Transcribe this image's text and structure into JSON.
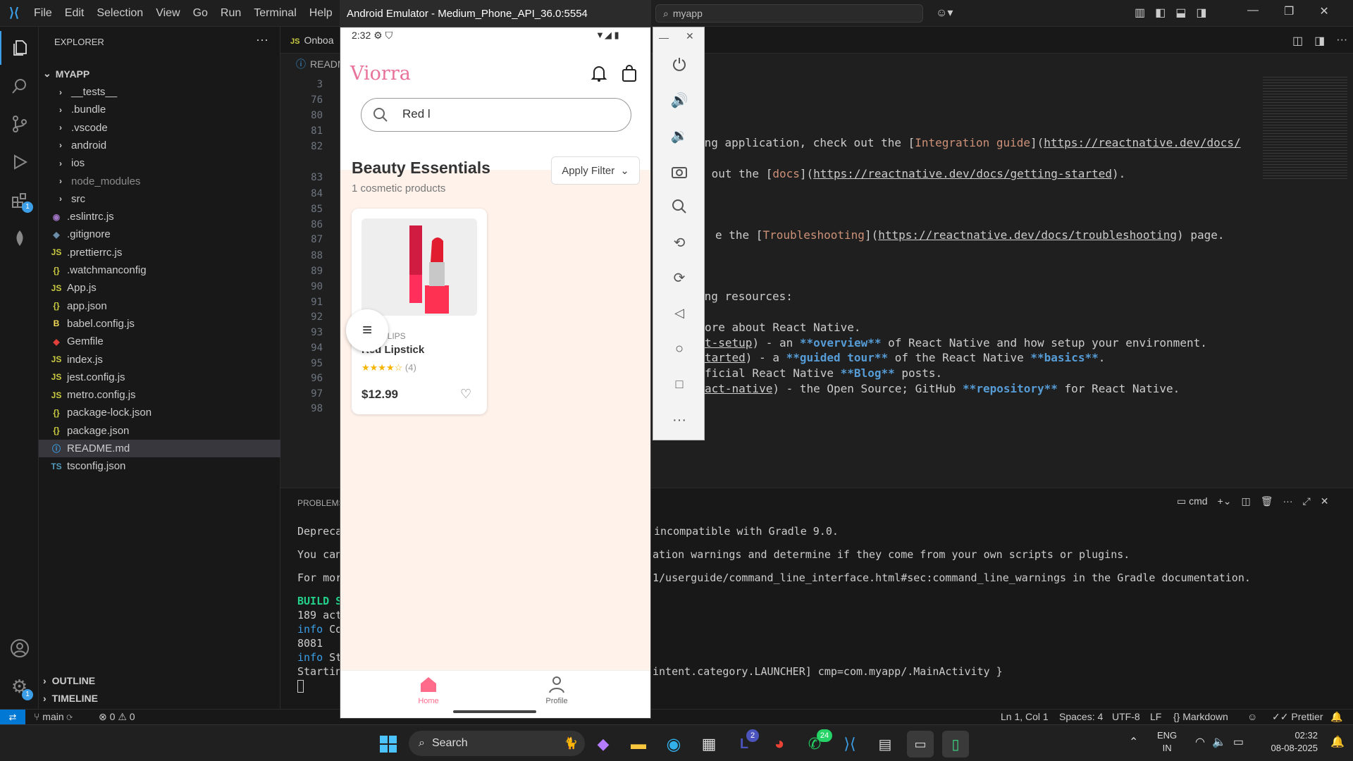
{
  "vscode": {
    "menu": [
      "File",
      "Edit",
      "Selection",
      "View",
      "Go",
      "Run",
      "Terminal",
      "Help"
    ],
    "command_center": "myapp",
    "explorer_title": "EXPLORER",
    "root_folder": "MYAPP",
    "tree": [
      {
        "name": "__tests__",
        "kind": "folder"
      },
      {
        "name": ".bundle",
        "kind": "folder"
      },
      {
        "name": ".vscode",
        "kind": "folder"
      },
      {
        "name": "android",
        "kind": "folder"
      },
      {
        "name": "ios",
        "kind": "folder"
      },
      {
        "name": "node_modules",
        "kind": "folder"
      },
      {
        "name": "src",
        "kind": "folder"
      },
      {
        "name": ".eslintrc.js",
        "kind": "eslint"
      },
      {
        "name": ".gitignore",
        "kind": "git"
      },
      {
        "name": ".prettierrc.js",
        "kind": "js"
      },
      {
        "name": ".watchmanconfig",
        "kind": "json"
      },
      {
        "name": "App.js",
        "kind": "js"
      },
      {
        "name": "app.json",
        "kind": "json"
      },
      {
        "name": "babel.config.js",
        "kind": "babel"
      },
      {
        "name": "Gemfile",
        "kind": "ruby"
      },
      {
        "name": "index.js",
        "kind": "js"
      },
      {
        "name": "jest.config.js",
        "kind": "js"
      },
      {
        "name": "metro.config.js",
        "kind": "js"
      },
      {
        "name": "package-lock.json",
        "kind": "json"
      },
      {
        "name": "package.json",
        "kind": "json"
      },
      {
        "name": "README.md",
        "kind": "info"
      },
      {
        "name": "tsconfig.json",
        "kind": "ts"
      }
    ],
    "outline_label": "OUTLINE",
    "timeline_label": "TIMELINE",
    "tab_partial": "Onboa",
    "breadcrumb_partial": "READM",
    "line_numbers": [
      "3",
      "76",
      "80",
      "81",
      "82",
      "83",
      "84",
      "85",
      "86",
      "87",
      "88",
      "89",
      "90",
      "91",
      "92",
      "93",
      "94",
      "95",
      "96",
      "97",
      "98"
    ],
    "code_fragments": {
      "l82a": "ing application, check out the [",
      "l82b": "Integration guide",
      "l82c": "](",
      "l82d": "https://reactnative.dev/docs/",
      "l83a": " out the [",
      "l83b": "docs",
      "l83c": "](",
      "l83d": "https://reactnative.dev/docs/getting-started",
      "l83e": ").",
      "l87a": "e the [",
      "l87b": "Troubleshooting",
      "l87c": "](",
      "l87d": "https://reactnative.dev/docs/troubleshooting",
      "l87e": ") page.",
      "l91": "ing resources:",
      "l93": "ore about React Native.",
      "l94a": "t-setup",
      "l94b": ") - an ",
      "l94c": "**overview**",
      "l94d": " of React Native and how setup your environment.",
      "l95a": "tarted",
      "l95b": ") - a ",
      "l95c": "**guided tour**",
      "l95d": " of the React Native ",
      "l95e": "**basics**",
      "l95f": ".",
      "l96a": "ficial React Native ",
      "l96b": "**Blog**",
      "l96c": " posts.",
      "l97a": "act-native",
      "l97b": ") - the Open Source; GitHub ",
      "l97c": "**repository**",
      "l97d": " for React Native."
    },
    "panel_tab": "PROBLEMS",
    "terminal_name": "cmd",
    "terminal_lines": {
      "t1a": "Deprecat",
      "t1b": "incompatible with Gradle 9.0.",
      "t2a": "You can",
      "t2b": "ation warnings and determine if they come from your own scripts or plugins.",
      "t3a": "For mor",
      "t3b": "1/userguide/command_line_interface.html#sec:command_line_warnings in the Gradle documentation.",
      "t4": "BUILD S",
      "t5": "189 act",
      "t6a": "info",
      "t6b": " Co",
      "t7": "8081",
      "t8a": "info",
      "t8b": " St",
      "t9a": "Startin",
      "t9b": "intent.category.LAUNCHER] cmp=com.myapp/.MainActivity }"
    },
    "status": {
      "branch": "main",
      "errors": "0",
      "warnings": "0",
      "position": "Ln 1, Col 1",
      "spaces": "Spaces: 4",
      "encoding": "UTF-8",
      "eol": "LF",
      "language": "Markdown",
      "prettier": "Prettier"
    },
    "badges": {
      "extensions": "1",
      "settings": "1"
    }
  },
  "emulator": {
    "title": "Android Emulator - Medium_Phone_API_36.0:5554",
    "status_time": "2:32",
    "app_logo": "Viorra",
    "search_value": "Red l",
    "section_title": "Beauty Essentials",
    "section_count": "1 cosmetic products",
    "filter_label": "Apply Filter",
    "product": {
      "brand": "GLOWLIPS",
      "name": "Red Lipstick",
      "reviews": "(4)",
      "price": "$12.99",
      "rating": 4
    },
    "nav": {
      "home": "Home",
      "profile": "Profile"
    },
    "colors": {
      "brand": "#e8729a",
      "bg": "#fff2eb",
      "card": "#ffffff"
    }
  },
  "taskbar": {
    "search": "Search",
    "badges": {
      "teams": "2",
      "whatsapp": "24"
    },
    "lang1": "ENG",
    "lang2": "IN",
    "time": "02:32",
    "date": "08-08-2025"
  }
}
